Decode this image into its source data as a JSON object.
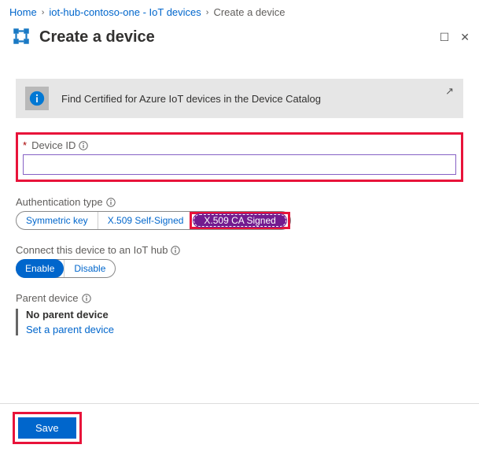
{
  "breadcrumb": {
    "home": "Home",
    "hub": "iot-hub-contoso-one - IoT devices",
    "current": "Create a device"
  },
  "title": "Create a device",
  "info_banner": "Find Certified for Azure IoT devices in the Device Catalog",
  "device_id": {
    "label": "Device ID",
    "value": ""
  },
  "auth_type": {
    "label": "Authentication type",
    "options": [
      "Symmetric key",
      "X.509 Self-Signed",
      "X.509 CA Signed"
    ],
    "selected": "X.509 CA Signed"
  },
  "connect": {
    "label": "Connect this device to an IoT hub",
    "options": [
      "Enable",
      "Disable"
    ],
    "selected": "Enable"
  },
  "parent": {
    "label": "Parent device",
    "none_text": "No parent device",
    "link_text": "Set a parent device"
  },
  "save_button": "Save"
}
